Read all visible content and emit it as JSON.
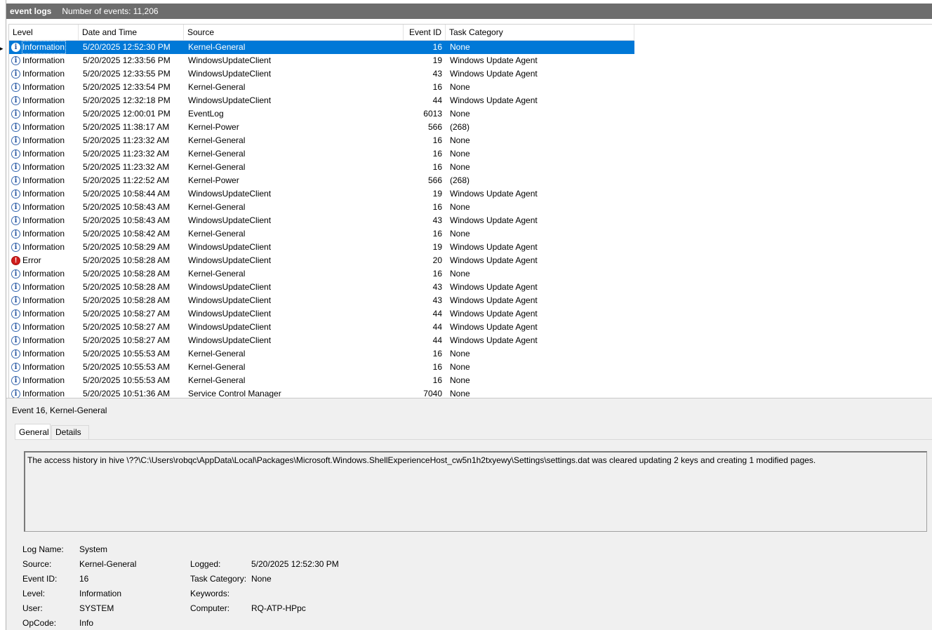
{
  "window": {
    "title": "event logs",
    "event_count": "Number of events: 11,206"
  },
  "grid": {
    "columns": [
      "Level",
      "Date and Time",
      "Source",
      "Event ID",
      "Task Category"
    ],
    "rows": [
      {
        "level": "Information",
        "icon": "info-icon",
        "date": "5/20/2025 12:52:30 PM",
        "source": "Kernel-General",
        "id": "16",
        "category": "None",
        "selected": true
      },
      {
        "level": "Information",
        "icon": "info-icon",
        "date": "5/20/2025 12:33:56 PM",
        "source": "WindowsUpdateClient",
        "id": "19",
        "category": "Windows Update Agent"
      },
      {
        "level": "Information",
        "icon": "info-icon",
        "date": "5/20/2025 12:33:55 PM",
        "source": "WindowsUpdateClient",
        "id": "43",
        "category": "Windows Update Agent"
      },
      {
        "level": "Information",
        "icon": "info-icon",
        "date": "5/20/2025 12:33:54 PM",
        "source": "Kernel-General",
        "id": "16",
        "category": "None"
      },
      {
        "level": "Information",
        "icon": "info-icon",
        "date": "5/20/2025 12:32:18 PM",
        "source": "WindowsUpdateClient",
        "id": "44",
        "category": "Windows Update Agent"
      },
      {
        "level": "Information",
        "icon": "info-icon",
        "date": "5/20/2025 12:00:01 PM",
        "source": "EventLog",
        "id": "6013",
        "category": "None"
      },
      {
        "level": "Information",
        "icon": "info-icon",
        "date": "5/20/2025 11:38:17 AM",
        "source": "Kernel-Power",
        "id": "566",
        "category": "(268)"
      },
      {
        "level": "Information",
        "icon": "info-icon",
        "date": "5/20/2025 11:23:32 AM",
        "source": "Kernel-General",
        "id": "16",
        "category": "None"
      },
      {
        "level": "Information",
        "icon": "info-icon",
        "date": "5/20/2025 11:23:32 AM",
        "source": "Kernel-General",
        "id": "16",
        "category": "None"
      },
      {
        "level": "Information",
        "icon": "info-icon",
        "date": "5/20/2025 11:23:32 AM",
        "source": "Kernel-General",
        "id": "16",
        "category": "None"
      },
      {
        "level": "Information",
        "icon": "info-icon",
        "date": "5/20/2025 11:22:52 AM",
        "source": "Kernel-Power",
        "id": "566",
        "category": "(268)"
      },
      {
        "level": "Information",
        "icon": "info-icon",
        "date": "5/20/2025 10:58:44 AM",
        "source": "WindowsUpdateClient",
        "id": "19",
        "category": "Windows Update Agent"
      },
      {
        "level": "Information",
        "icon": "info-icon",
        "date": "5/20/2025 10:58:43 AM",
        "source": "Kernel-General",
        "id": "16",
        "category": "None"
      },
      {
        "level": "Information",
        "icon": "info-icon",
        "date": "5/20/2025 10:58:43 AM",
        "source": "WindowsUpdateClient",
        "id": "43",
        "category": "Windows Update Agent"
      },
      {
        "level": "Information",
        "icon": "info-icon",
        "date": "5/20/2025 10:58:42 AM",
        "source": "Kernel-General",
        "id": "16",
        "category": "None"
      },
      {
        "level": "Information",
        "icon": "info-icon",
        "date": "5/20/2025 10:58:29 AM",
        "source": "WindowsUpdateClient",
        "id": "19",
        "category": "Windows Update Agent"
      },
      {
        "level": "Error",
        "icon": "error-icon",
        "date": "5/20/2025 10:58:28 AM",
        "source": "WindowsUpdateClient",
        "id": "20",
        "category": "Windows Update Agent"
      },
      {
        "level": "Information",
        "icon": "info-icon",
        "date": "5/20/2025 10:58:28 AM",
        "source": "Kernel-General",
        "id": "16",
        "category": "None"
      },
      {
        "level": "Information",
        "icon": "info-icon",
        "date": "5/20/2025 10:58:28 AM",
        "source": "WindowsUpdateClient",
        "id": "43",
        "category": "Windows Update Agent"
      },
      {
        "level": "Information",
        "icon": "info-icon",
        "date": "5/20/2025 10:58:28 AM",
        "source": "WindowsUpdateClient",
        "id": "43",
        "category": "Windows Update Agent"
      },
      {
        "level": "Information",
        "icon": "info-icon",
        "date": "5/20/2025 10:58:27 AM",
        "source": "WindowsUpdateClient",
        "id": "44",
        "category": "Windows Update Agent"
      },
      {
        "level": "Information",
        "icon": "info-icon",
        "date": "5/20/2025 10:58:27 AM",
        "source": "WindowsUpdateClient",
        "id": "44",
        "category": "Windows Update Agent"
      },
      {
        "level": "Information",
        "icon": "info-icon",
        "date": "5/20/2025 10:58:27 AM",
        "source": "WindowsUpdateClient",
        "id": "44",
        "category": "Windows Update Agent"
      },
      {
        "level": "Information",
        "icon": "info-icon",
        "date": "5/20/2025 10:55:53 AM",
        "source": "Kernel-General",
        "id": "16",
        "category": "None"
      },
      {
        "level": "Information",
        "icon": "info-icon",
        "date": "5/20/2025 10:55:53 AM",
        "source": "Kernel-General",
        "id": "16",
        "category": "None"
      },
      {
        "level": "Information",
        "icon": "info-icon",
        "date": "5/20/2025 10:55:53 AM",
        "source": "Kernel-General",
        "id": "16",
        "category": "None"
      },
      {
        "level": "Information",
        "icon": "info-icon",
        "date": "5/20/2025 10:51:36 AM",
        "source": "Service Control Manager",
        "id": "7040",
        "category": "None"
      }
    ]
  },
  "details": {
    "title": "Event 16, Kernel-General",
    "tabs": {
      "general": "General",
      "details": "Details"
    },
    "description": "The access history in hive \\??\\C:\\Users\\robqc\\AppData\\Local\\Packages\\Microsoft.Windows.ShellExperienceHost_cw5n1h2txyewy\\Settings\\settings.dat was cleared updating 2 keys and creating 1 modified pages.",
    "labels": {
      "log_name": "Log Name:",
      "source": "Source:",
      "event_id": "Event ID:",
      "level": "Level:",
      "user": "User:",
      "opcode": "OpCode:",
      "logged": "Logged:",
      "task_category": "Task Category:",
      "keywords": "Keywords:",
      "computer": "Computer:"
    },
    "values": {
      "log_name": "System",
      "source": "Kernel-General",
      "event_id": "16",
      "level": "Information",
      "user": "SYSTEM",
      "opcode": "Info",
      "logged": "5/20/2025 12:52:30 PM",
      "task_category": "None",
      "keywords": "",
      "computer": "RQ-ATP-HPpc"
    }
  },
  "colors": {
    "title_bar": "#6d6d6d",
    "selection": "#0078d7",
    "panel": "#f0f0f0",
    "error": "#d01e1e",
    "info": "#1f4f9c"
  }
}
